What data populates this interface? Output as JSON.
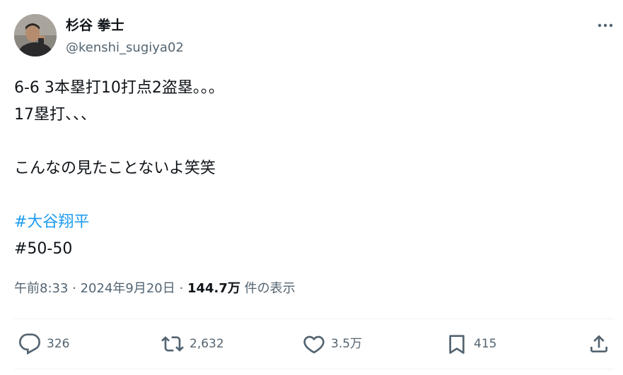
{
  "author": {
    "name": "杉谷 拳士",
    "handle": "@kenshi_sugiya02"
  },
  "tweet": {
    "lines": [
      "6-6 3本塁打10打点2盗塁。。。",
      "17塁打、、、",
      "",
      "こんなの見たことないよ笑笑",
      ""
    ],
    "hashtags": [
      "#大谷翔平",
      "#50-50"
    ]
  },
  "meta": {
    "time": "午前8:33",
    "sep1": " · ",
    "date": "2024年9月20日",
    "sep2": " · ",
    "views_count": "144.7万",
    "views_label": " 件の表示"
  },
  "actions": {
    "reply_count": "326",
    "retweet_count": "2,632",
    "like_count": "3.5万",
    "bookmark_count": "415"
  },
  "colors": {
    "link": "#1d9bf0",
    "text": "#0f1419",
    "secondary": "#536471",
    "divider": "#eff3f4"
  },
  "icons": [
    "more-icon",
    "reply-icon",
    "retweet-icon",
    "like-icon",
    "bookmark-icon",
    "share-icon"
  ]
}
